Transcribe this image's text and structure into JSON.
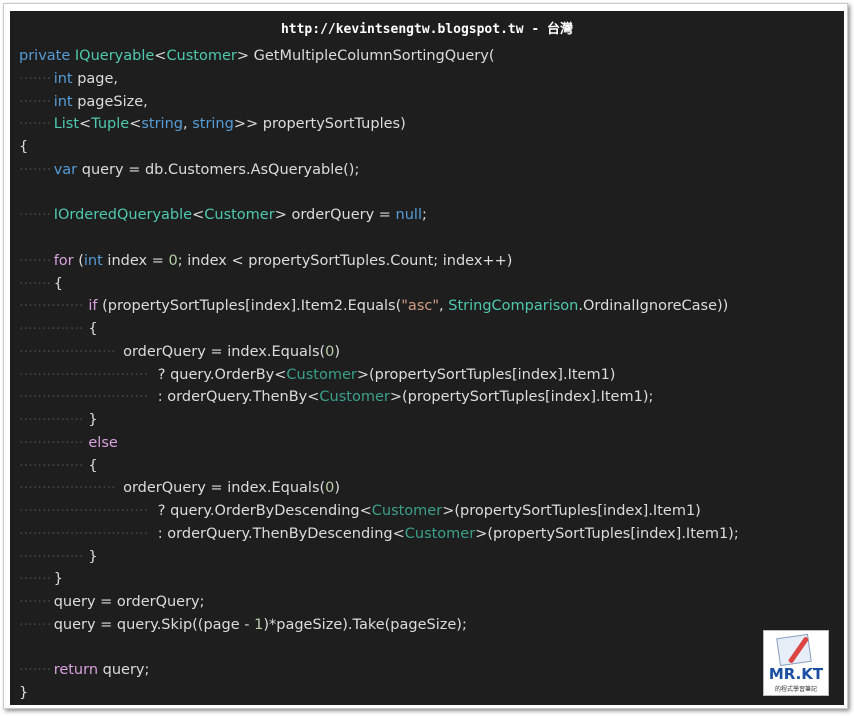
{
  "header": {
    "title": "http://kevintsengtw.blogspot.tw - 台灣"
  },
  "watermark": {
    "logo_text": "MR.KT",
    "logo_sub": "的程式學習筆記"
  },
  "colors": {
    "background": "#1e1e1e",
    "keyword": "#569cd6",
    "control_keyword": "#d8a0df",
    "type": "#4ec9b0",
    "number": "#b5cea8",
    "string": "#d69d85",
    "text": "#dcdcdc"
  },
  "code": {
    "lines": [
      {
        "indent": 0,
        "tokens": [
          [
            "kw",
            "private"
          ],
          [
            "ident",
            " "
          ],
          [
            "type",
            "IQueryable"
          ],
          [
            "ident",
            "<"
          ],
          [
            "type",
            "Customer"
          ],
          [
            "ident",
            "> GetMultipleColumnSortingQuery("
          ]
        ]
      },
      {
        "indent": 1,
        "tokens": [
          [
            "kw",
            "int"
          ],
          [
            "ident",
            " page,"
          ]
        ]
      },
      {
        "indent": 1,
        "tokens": [
          [
            "kw",
            "int"
          ],
          [
            "ident",
            " pageSize,"
          ]
        ]
      },
      {
        "indent": 1,
        "tokens": [
          [
            "type",
            "List"
          ],
          [
            "ident",
            "<"
          ],
          [
            "type",
            "Tuple"
          ],
          [
            "ident",
            "<"
          ],
          [
            "kw",
            "string"
          ],
          [
            "ident",
            ", "
          ],
          [
            "kw",
            "string"
          ],
          [
            "ident",
            ">> propertySortTuples)"
          ]
        ]
      },
      {
        "indent": 0,
        "tokens": [
          [
            "ident",
            "{"
          ]
        ]
      },
      {
        "indent": 1,
        "tokens": [
          [
            "kw",
            "var"
          ],
          [
            "ident",
            " query = db.Customers.AsQueryable();"
          ]
        ]
      },
      {
        "indent": -1,
        "tokens": []
      },
      {
        "indent": 1,
        "tokens": [
          [
            "type",
            "IOrderedQueryable"
          ],
          [
            "ident",
            "<"
          ],
          [
            "type",
            "Customer"
          ],
          [
            "ident",
            "> orderQuery = "
          ],
          [
            "kw",
            "null"
          ],
          [
            "ident",
            ";"
          ]
        ]
      },
      {
        "indent": -1,
        "tokens": []
      },
      {
        "indent": 1,
        "tokens": [
          [
            "kw-ctl",
            "for"
          ],
          [
            "ident",
            " ("
          ],
          [
            "kw",
            "int"
          ],
          [
            "ident",
            " index = "
          ],
          [
            "num",
            "0"
          ],
          [
            "ident",
            "; index < propertySortTuples.Count; index++)"
          ]
        ]
      },
      {
        "indent": 1,
        "tokens": [
          [
            "ident",
            "{"
          ]
        ]
      },
      {
        "indent": 2,
        "tokens": [
          [
            "kw-ctl",
            "if"
          ],
          [
            "ident",
            " (propertySortTuples[index].Item2.Equals("
          ],
          [
            "str",
            "\"asc\""
          ],
          [
            "ident",
            ", "
          ],
          [
            "type",
            "StringComparison"
          ],
          [
            "ident",
            ".OrdinalIgnoreCase))"
          ]
        ]
      },
      {
        "indent": 2,
        "tokens": [
          [
            "ident",
            "{"
          ]
        ]
      },
      {
        "indent": 3,
        "tokens": [
          [
            "ident",
            "orderQuery = index.Equals("
          ],
          [
            "num",
            "0"
          ],
          [
            "ident",
            ")"
          ]
        ]
      },
      {
        "indent": 4,
        "tokens": [
          [
            "ident",
            "? query.OrderBy<"
          ],
          [
            "type-dim",
            "Customer"
          ],
          [
            "ident",
            ">(propertySortTuples[index].Item1)"
          ]
        ]
      },
      {
        "indent": 4,
        "tokens": [
          [
            "ident",
            ": orderQuery.ThenBy<"
          ],
          [
            "type-dim",
            "Customer"
          ],
          [
            "ident",
            ">(propertySortTuples[index].Item1);"
          ]
        ]
      },
      {
        "indent": 2,
        "tokens": [
          [
            "ident",
            "}"
          ]
        ]
      },
      {
        "indent": 2,
        "tokens": [
          [
            "kw-ctl",
            "else"
          ]
        ]
      },
      {
        "indent": 2,
        "tokens": [
          [
            "ident",
            "{"
          ]
        ]
      },
      {
        "indent": 3,
        "tokens": [
          [
            "ident",
            "orderQuery = index.Equals("
          ],
          [
            "num",
            "0"
          ],
          [
            "ident",
            ")"
          ]
        ]
      },
      {
        "indent": 4,
        "tokens": [
          [
            "ident",
            "? query.OrderByDescending<"
          ],
          [
            "type-dim",
            "Customer"
          ],
          [
            "ident",
            ">(propertySortTuples[index].Item1)"
          ]
        ]
      },
      {
        "indent": 4,
        "tokens": [
          [
            "ident",
            ": orderQuery.ThenByDescending<"
          ],
          [
            "type-dim",
            "Customer"
          ],
          [
            "ident",
            ">(propertySortTuples[index].Item1);"
          ]
        ]
      },
      {
        "indent": 2,
        "tokens": [
          [
            "ident",
            "}"
          ]
        ]
      },
      {
        "indent": 1,
        "tokens": [
          [
            "ident",
            "}"
          ]
        ]
      },
      {
        "indent": 1,
        "tokens": [
          [
            "ident",
            "query = orderQuery;"
          ]
        ]
      },
      {
        "indent": 1,
        "tokens": [
          [
            "ident",
            "query = query.Skip((page - "
          ],
          [
            "num",
            "1"
          ],
          [
            "ident",
            ")*pageSize).Take(pageSize);"
          ]
        ]
      },
      {
        "indent": -1,
        "tokens": []
      },
      {
        "indent": 1,
        "tokens": [
          [
            "kw-ctl",
            "return"
          ],
          [
            "ident",
            " query;"
          ]
        ]
      },
      {
        "indent": 0,
        "tokens": [
          [
            "ident",
            "}"
          ]
        ]
      }
    ]
  }
}
